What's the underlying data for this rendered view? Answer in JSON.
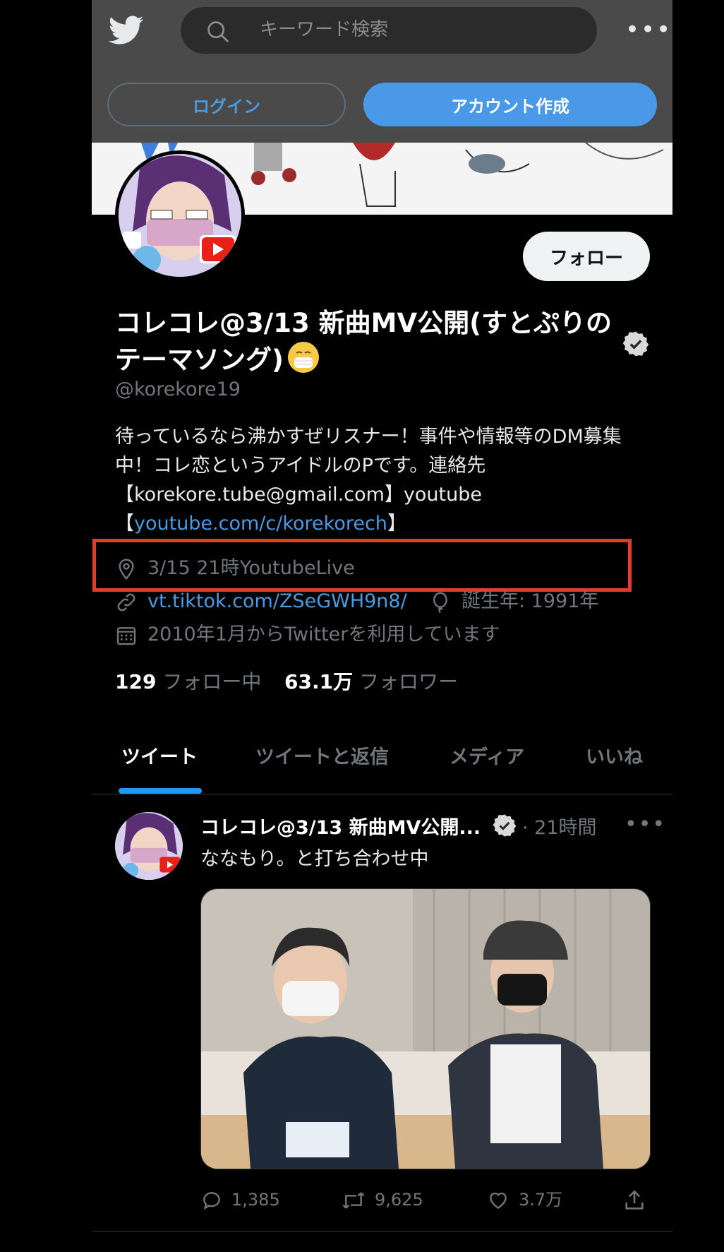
{
  "topbar": {
    "search_placeholder": "キーワード検索",
    "more": "•••",
    "login_label": "ログイン",
    "signup_label": "アカウント作成"
  },
  "profile": {
    "follow_label": "フォロー",
    "display_name": "コレコレ@3/13 新曲MV公開(すとぷりのテーマソング)",
    "handle": "@korekore19",
    "bio_text": "待っているなら沸かすぜリスナー！事件や情報等のDM募集中！コレ恋というアイドルのPです。連絡先【korekore.tube@gmail.com】youtube【",
    "bio_link": "youtube.com/c/korekorech",
    "bio_end": "】",
    "location": "3/15 21時YoutubeLive",
    "website": "vt.tiktok.com/ZSeGWH9n8/",
    "birthday": "誕生年: 1991年",
    "joined": "2010年1月からTwitterを利用しています",
    "following_count": "129",
    "following_label": "フォロー中",
    "followers_count": "63.1万",
    "followers_label": "フォロワー"
  },
  "tabs": [
    {
      "label": "ツイート",
      "active": true
    },
    {
      "label": "ツイートと返信",
      "active": false
    },
    {
      "label": "メディア",
      "active": false
    },
    {
      "label": "いいね",
      "active": false
    }
  ],
  "tweet": {
    "name": "コレコレ@3/13 新曲MV公開...",
    "time": "· 21時間",
    "more": "•••",
    "text": "ななもり。と打ち合わせ中",
    "replies": "1,385",
    "retweets": "9,625",
    "likes": "3.7万"
  },
  "colors": {
    "accent": "#1d9bf0",
    "highlight_box": "#e03d2f",
    "link": "#4a9ae0"
  }
}
